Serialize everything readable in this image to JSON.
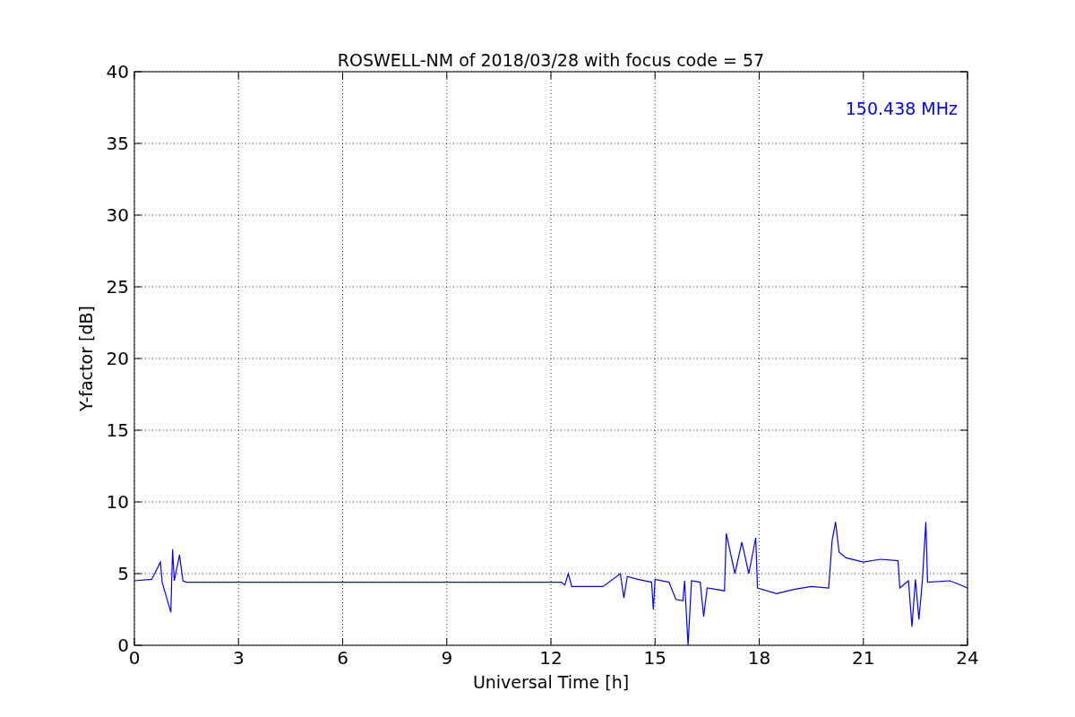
{
  "figure": {
    "chart_data": {
      "type": "line",
      "title": "ROSWELL-NM of 2018/03/28 with focus code = 57",
      "xlabel": "Universal Time [h]",
      "ylabel": "Y-factor [dB]",
      "x": [
        0,
        0.5,
        0.75,
        0.8,
        1.05,
        1.1,
        1.15,
        1.3,
        1.4,
        1.5,
        12.3,
        12.4,
        12.5,
        12.6,
        13.5,
        14,
        14.1,
        14.2,
        14.5,
        14.9,
        14.95,
        15,
        15.4,
        15.6,
        15.8,
        15.85,
        15.95,
        16.05,
        16.3,
        16.4,
        16.5,
        17,
        17.05,
        17.3,
        17.5,
        17.7,
        17.9,
        17.95,
        18.5,
        19,
        19.5,
        20,
        20.1,
        20.2,
        20.3,
        20.5,
        21,
        21.5,
        22,
        22.05,
        22.3,
        22.4,
        22.5,
        22.6,
        22.7,
        22.8,
        22.85,
        23.5,
        24
      ],
      "series": [
        {
          "name": "150.438 MHz",
          "color": "#0000ff",
          "values": [
            4.5,
            4.6,
            5.8,
            4.4,
            2.3,
            6.7,
            4.5,
            6.3,
            4.5,
            4.4,
            4.4,
            4.2,
            5.0,
            4.1,
            4.1,
            5.0,
            3.3,
            4.8,
            4.6,
            4.4,
            2.5,
            4.6,
            4.4,
            3.2,
            3.1,
            4.5,
            0,
            4.5,
            4.4,
            2.0,
            4.0,
            3.8,
            7.8,
            5.0,
            7.2,
            5.0,
            7.5,
            4.0,
            3.6,
            3.9,
            4.1,
            4.0,
            7.3,
            8.6,
            6.5,
            6.1,
            5.8,
            6.0,
            5.9,
            4.0,
            4.5,
            1.3,
            4.6,
            1.8,
            4.5,
            8.6,
            4.4,
            4.5,
            4.0
          ]
        }
      ],
      "xlim": [
        0,
        24
      ],
      "ylim": [
        0,
        40
      ],
      "xticks": [
        0,
        3,
        6,
        9,
        12,
        15,
        18,
        21,
        24
      ],
      "yticks": [
        0,
        5,
        10,
        15,
        20,
        25,
        30,
        35,
        40
      ],
      "grid": true
    }
  }
}
